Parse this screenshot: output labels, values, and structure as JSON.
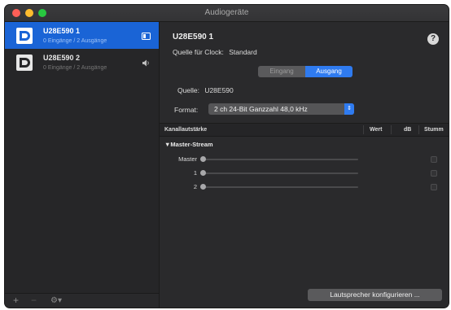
{
  "window": {
    "title": "Audiogeräte"
  },
  "devices": [
    {
      "name": "U28E590 1",
      "sub": "0 Eingänge / 2 Ausgänge",
      "selected": true
    },
    {
      "name": "U28E590 2",
      "sub": "0 Eingänge / 2 Ausgänge",
      "selected": false
    }
  ],
  "sidebar_bottom": {
    "add": "+",
    "remove": "−",
    "gear": "⚙▾"
  },
  "main": {
    "device_title": "U28E590 1",
    "clock_label": "Quelle für Clock:",
    "clock_value": "Standard",
    "help": "?",
    "tabs": [
      {
        "label": "Eingang",
        "active": false
      },
      {
        "label": "Ausgang",
        "active": true
      }
    ],
    "source_label": "Quelle:",
    "source_value": "U28E590",
    "format_label": "Format:",
    "format_value": "2 ch 24-Bit Ganzzahl 48,0 kHz",
    "table": {
      "headers": {
        "volume": "Kanallautstärke",
        "value": "Wert",
        "db": "dB",
        "mute": "Stumm"
      },
      "group": "▼Master-Stream",
      "channels": [
        "Master",
        "1",
        "2"
      ]
    },
    "config_button": "Lautsprecher konfigurieren ..."
  }
}
